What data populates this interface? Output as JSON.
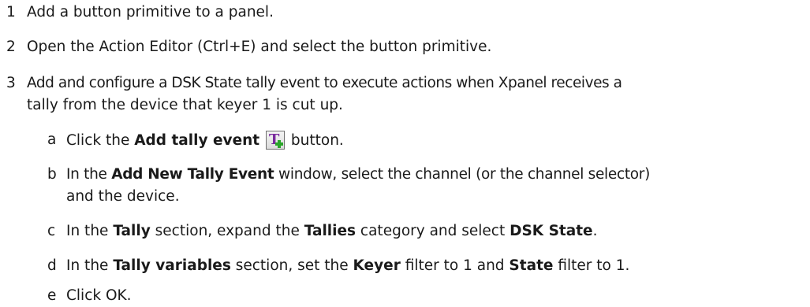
{
  "steps": [
    {
      "num": "1",
      "text": "Add a button primitive to a panel."
    },
    {
      "num": "2",
      "text": "Open the Action Editor (Ctrl+E) and select the button primitive."
    },
    {
      "num": "3",
      "line1": "Add and configure a DSK State tally event to execute actions when Xpanel receives a",
      "line2": "tally from the device that keyer 1 is cut up."
    }
  ],
  "substeps": {
    "a": {
      "letter": "a",
      "pre": "Click the ",
      "bold": "Add tally event",
      "icon": "add-tally-event-icon",
      "post": " button."
    },
    "b": {
      "letter": "b",
      "pre": "In the ",
      "bold": "Add New Tally Event",
      "post_line1": " window, select the channel (or the channel selector)",
      "line2": "and the device."
    },
    "c": {
      "letter": "c",
      "pre": "In the ",
      "bold1": "Tally",
      "mid1": " section, expand the ",
      "bold2": "Tallies",
      "mid2": " category and select ",
      "bold3": "DSK State",
      "post": "."
    },
    "d": {
      "letter": "d",
      "pre": "In the ",
      "bold1": "Tally variables",
      "mid1": " section, set the ",
      "bold2": "Keyer",
      "mid2": " filter to 1 and ",
      "bold3": "State",
      "post": " filter to 1."
    },
    "e": {
      "letter": "e",
      "text": "Click OK."
    }
  }
}
